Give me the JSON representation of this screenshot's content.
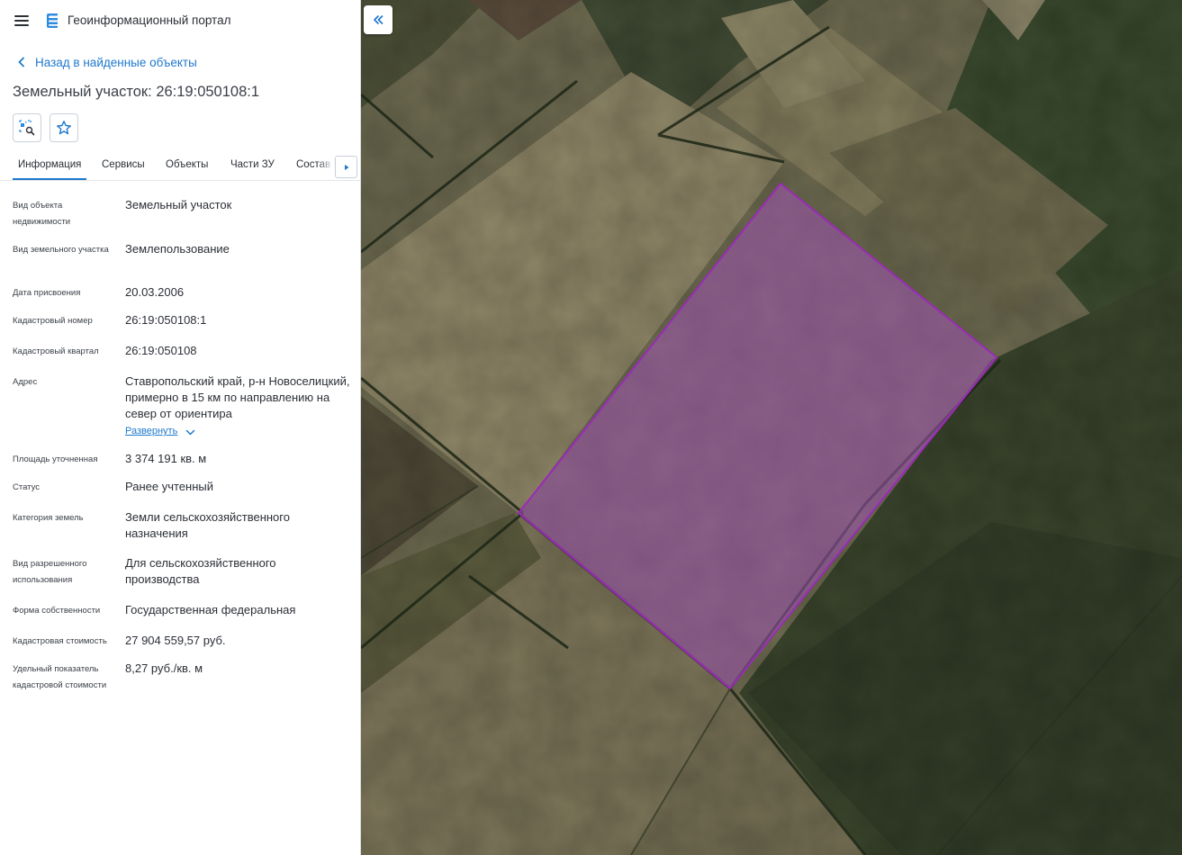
{
  "header": {
    "menu_icon": "menu-icon",
    "logo_icon": "portal-logo-icon",
    "title": "Геоинформационный портал"
  },
  "navigation": {
    "back_icon": "chevron-left-icon",
    "back_label": "Назад в найденные объекты"
  },
  "object": {
    "title": "Земельный участок: 26:19:050108:1",
    "actions": [
      {
        "icon": "zoom-to-object-icon"
      },
      {
        "icon": "star-icon"
      }
    ]
  },
  "tabs": [
    {
      "label": "Информация",
      "active": true
    },
    {
      "label": "Сервисы",
      "active": false
    },
    {
      "label": "Объекты",
      "active": false
    },
    {
      "label": "Части ЗУ",
      "active": false
    },
    {
      "label": "Состав ЕЗП",
      "active": false
    }
  ],
  "tabs_next_icon": "caret-right-icon",
  "properties": [
    {
      "label": "Вид объекта недвижимости",
      "value": "Земельный участок"
    },
    {
      "label": "Вид земельного участка",
      "value": "Землепользование"
    },
    {
      "label": "Дата присвоения",
      "value": "20.03.2006"
    },
    {
      "label": "Кадастровый номер",
      "value": "26:19:050108:1"
    },
    {
      "label": "Кадастровый квартал",
      "value": "26:19:050108"
    },
    {
      "label": "Адрес",
      "value": "Ставропольский край, р-н Новоселицкий, примерно в 15 км по направлению на север от ориентира"
    },
    {
      "label": "Площадь уточненная",
      "value": "3 374 191 кв. м"
    },
    {
      "label": "Статус",
      "value": "Ранее учтенный"
    },
    {
      "label": "Категория земель",
      "value": "Земли сельскохозяйственного назначения"
    },
    {
      "label": "Вид разрешенного использования",
      "value": "Для сельскохозяйственного производства"
    },
    {
      "label": "Форма собственности",
      "value": "Государственная федеральная"
    },
    {
      "label": "Кадастровая стоимость",
      "value": "27 904 559,57 руб."
    },
    {
      "label": "Удельный показатель кадастровой стоимости",
      "value": "8,27 руб./кв. м"
    }
  ],
  "address_expand": {
    "label": "Развернуть",
    "icon": "chevron-down-icon"
  },
  "map": {
    "collapse_icon": "double-chevron-left-icon",
    "layer": "satellite imagery",
    "parcel_fill": "#a055b4",
    "parcel_stroke": "#9b2bb8"
  }
}
